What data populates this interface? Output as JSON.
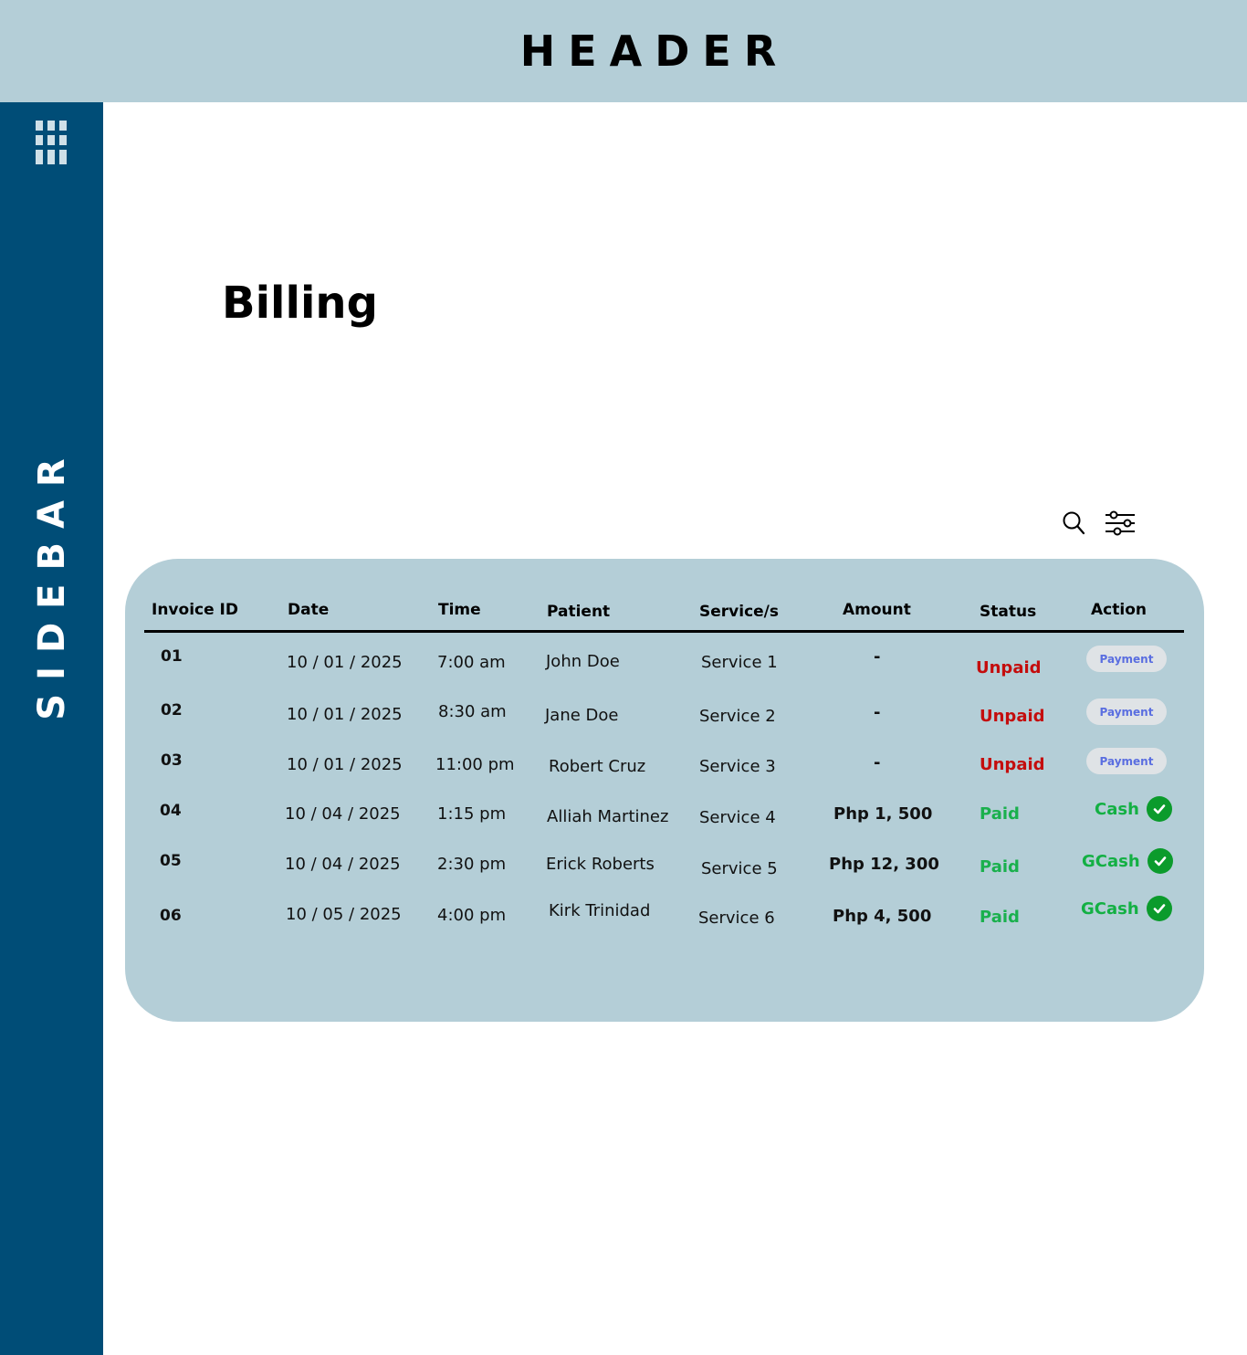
{
  "header": {
    "title": "HEADER"
  },
  "sidebar": {
    "label": "SIDEBAR",
    "menu_icon": "hamburger-menu-icon"
  },
  "main": {
    "page_title": "Billing",
    "toolbar": {
      "search_icon": "search-icon",
      "filter_icon": "filter-sliders-icon"
    }
  },
  "colors": {
    "header_bg": "#b4ced7",
    "sidebar_bg": "#004d77",
    "table_bg": "#b4ced7",
    "unpaid": "#c40d0d",
    "paid": "#1ab04d",
    "payment_button_text": "#5a6ee0",
    "check_badge": "#0b9b2c"
  },
  "table": {
    "columns": [
      "Invoice ID",
      "Date",
      "Time",
      "Patient",
      "Service/s",
      "Amount",
      "Status",
      "Action"
    ],
    "rows": [
      {
        "id": "01",
        "date": "10 / 01 / 2025",
        "time": "7:00 am",
        "patient": "John Doe",
        "service": "Service 1",
        "amount": "-",
        "status": "Unpaid",
        "action": "Payment"
      },
      {
        "id": "02",
        "date": "10 / 01 / 2025",
        "time": "8:30 am",
        "patient": "Jane Doe",
        "service": "Service 2",
        "amount": "-",
        "status": "Unpaid",
        "action": "Payment"
      },
      {
        "id": "03",
        "date": "10 / 01 / 2025",
        "time": "11:00 pm",
        "patient": "Robert Cruz",
        "service": "Service 3",
        "amount": "-",
        "status": "Unpaid",
        "action": "Payment"
      },
      {
        "id": "04",
        "date": "10 / 04 / 2025",
        "time": "1:15 pm",
        "patient": "Alliah Martinez",
        "service": "Service 4",
        "amount": "Php 1, 500",
        "status": "Paid",
        "action": "Cash"
      },
      {
        "id": "05",
        "date": "10 / 04 / 2025",
        "time": "2:30 pm",
        "patient": "Erick Roberts",
        "service": "Service 5",
        "amount": "Php 12, 300",
        "status": "Paid",
        "action": "GCash"
      },
      {
        "id": "06",
        "date": "10 / 05 / 2025",
        "time": "4:00 pm",
        "patient": "Kirk Trinidad",
        "service": "Service 6",
        "amount": "Php 4, 500",
        "status": "Paid",
        "action": "GCash"
      }
    ]
  }
}
